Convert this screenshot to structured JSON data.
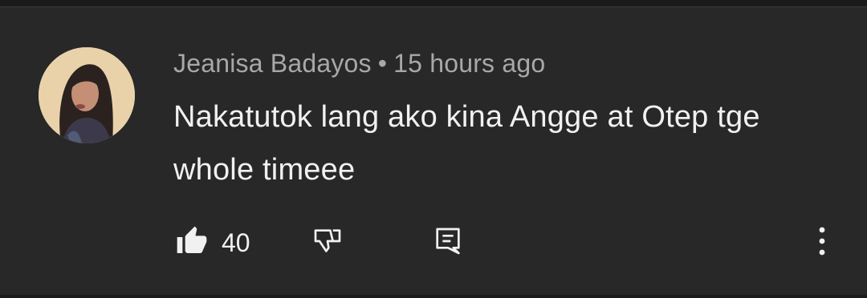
{
  "comment": {
    "author": "Jeanisa Badayos",
    "separator": "•",
    "timestamp": "15 hours ago",
    "text": "Nakatutok lang ako kina Angge at Otep tge whole timeee",
    "likes": "40"
  },
  "icons": {
    "like": "thumbs-up-icon",
    "dislike": "thumbs-down-icon",
    "reply": "comment-reply-icon",
    "more": "more-vertical-icon"
  },
  "colors": {
    "background": "#282828",
    "primary_text": "#f1f1f1",
    "secondary_text": "#a8a8a8"
  }
}
